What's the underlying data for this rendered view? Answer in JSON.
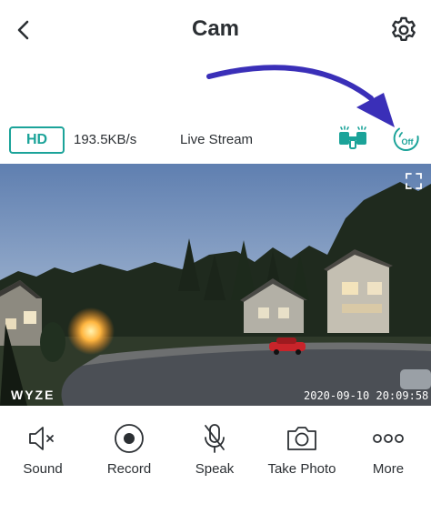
{
  "header": {
    "title": "Cam",
    "back_icon": "chevron-left-icon",
    "settings_icon": "gear-icon"
  },
  "status": {
    "quality_label": "HD",
    "bitrate": "193.5KB/s",
    "mode_label": "Live Stream",
    "floodlight_icon": "floodlight-icon",
    "motion_detection_label": "Off"
  },
  "video": {
    "brand_watermark": "WYZE",
    "timestamp": "2020-09-10 20:09:58"
  },
  "controls": [
    {
      "label": "Sound",
      "icon": "speaker-muted-icon"
    },
    {
      "label": "Record",
      "icon": "record-icon"
    },
    {
      "label": "Speak",
      "icon": "microphone-muted-icon"
    },
    {
      "label": "Take Photo",
      "icon": "camera-icon"
    },
    {
      "label": "More",
      "icon": "more-dots-icon"
    }
  ],
  "colors": {
    "accent": "#1ba399",
    "annotation_arrow": "#3a2fb8",
    "text": "#2b2f33"
  }
}
